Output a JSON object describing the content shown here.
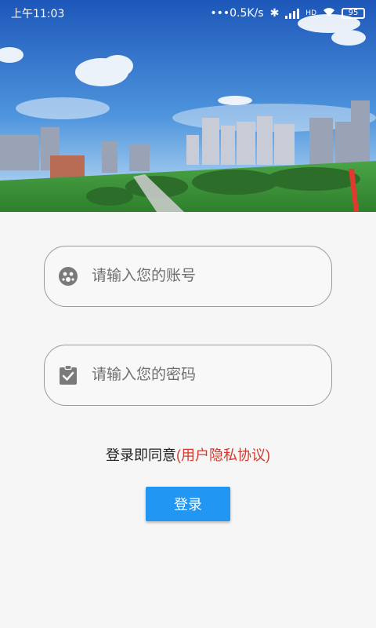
{
  "status_bar": {
    "time": "上午11:03",
    "network_speed": "0.5K/s",
    "signal_type": "HD",
    "battery": "95"
  },
  "hero": {
    "image_desc": "city-skyline-photo",
    "sky_color": "#2f6fce",
    "grass_color": "#3e9b3a"
  },
  "login": {
    "account_placeholder": "请输入您的账号",
    "password_placeholder": "请输入您的密码",
    "account_icon": "user-face-icon",
    "password_icon": "clipboard-check-icon",
    "agreement_prefix": "登录即同意",
    "agreement_link": "(用户隐私协议)",
    "login_button": "登录"
  },
  "colors": {
    "primary": "#2196f3",
    "link": "#d43a2f"
  }
}
